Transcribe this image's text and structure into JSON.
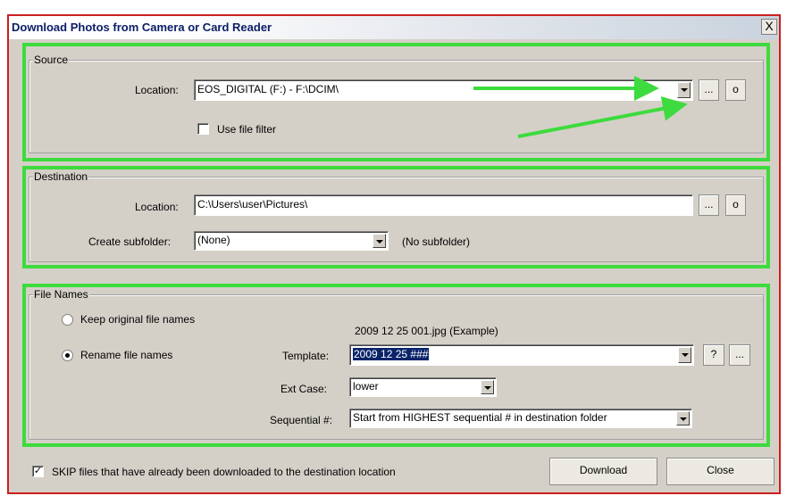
{
  "window": {
    "title": "Download Photos from Camera or Card Reader",
    "close_glyph": "X"
  },
  "source": {
    "legend": "Source",
    "location_label": "Location:",
    "location_value": "EOS_DIGITAL (F:) - F:\\DCIM\\",
    "browse_label": "...",
    "open_label": "o",
    "file_filter_label": "Use file filter",
    "file_filter_checked": false
  },
  "destination": {
    "legend": "Destination",
    "location_label": "Location:",
    "location_value": "C:\\Users\\user\\Pictures\\",
    "browse_label": "...",
    "open_label": "o",
    "subfolder_label": "Create subfolder:",
    "subfolder_value": "(None)",
    "subfolder_hint": "(No subfolder)"
  },
  "file_names": {
    "legend": "File Names",
    "keep_label": "Keep original file names",
    "rename_label": "Rename file names",
    "selected_option": "rename",
    "example": "2009 12 25 001.jpg  (Example)",
    "template_label": "Template:",
    "template_value": "2009 12 25 ###",
    "help_label": "?",
    "browse_label": "...",
    "ext_case_label": "Ext Case:",
    "ext_case_value": "lower",
    "sequential_label": "Sequential #:",
    "sequential_value": "Start from HIGHEST sequential # in destination folder"
  },
  "footer": {
    "skip_label": "SKIP files that have already been downloaded to the destination location",
    "skip_checked": true,
    "download_label": "Download",
    "close_label": "Close"
  },
  "colors": {
    "highlight": "#3ddb3d",
    "window_border": "#cc1f1f",
    "title_text": "#0b1e66",
    "dialog_bg": "#d4d0c8"
  },
  "glyphs": {
    "check": "✓"
  }
}
